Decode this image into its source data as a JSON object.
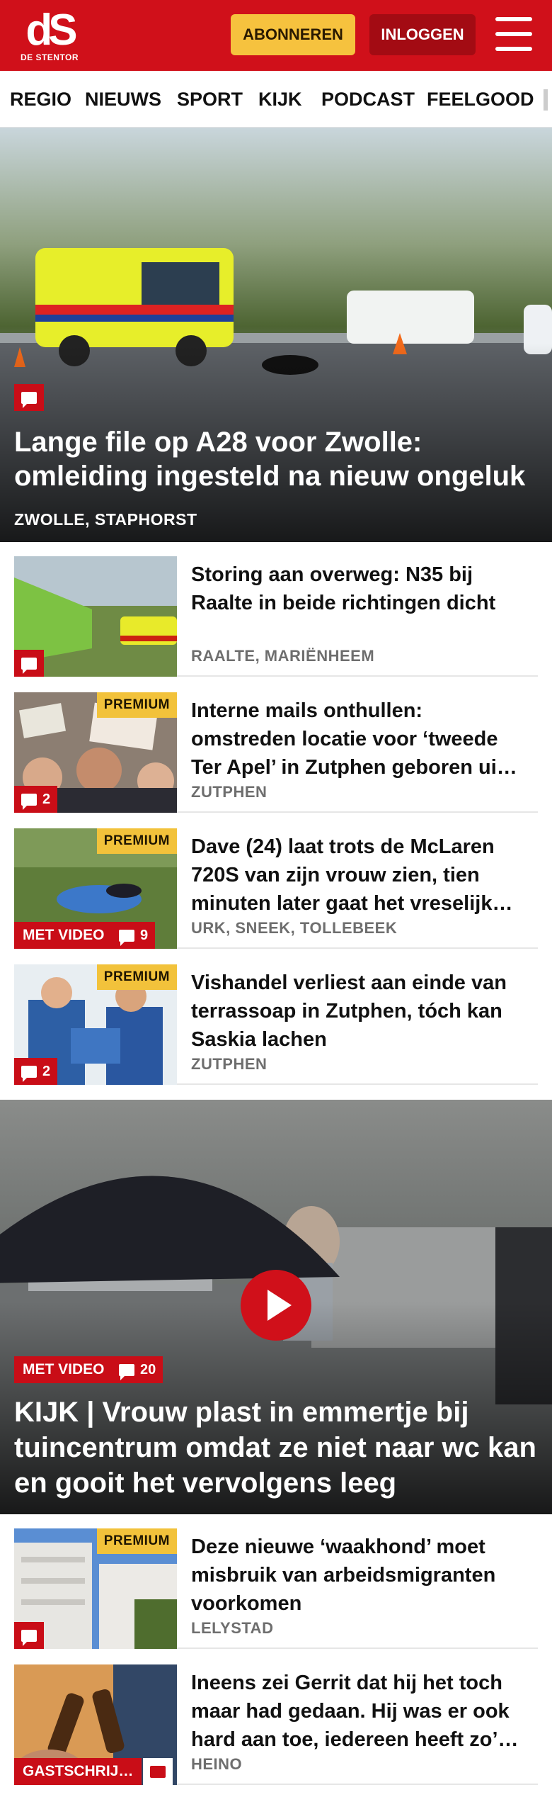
{
  "header": {
    "logo_mark": "dS",
    "logo_sub": "DE STENTOR",
    "subscribe_label": "ABONNEREN",
    "login_label": "INLOGGEN",
    "brand_color": "#d0101a"
  },
  "nav": {
    "items": [
      "REGIO",
      "NIEUWS",
      "SPORT",
      "KIJK",
      "PODCAST",
      "FEELGOOD"
    ]
  },
  "hero": {
    "title": "Lange file op A28 voor Zwolle: omleiding ingesteld na nieuw ongeluk",
    "location": "ZWOLLE, STAPHORST",
    "icon": "comment-icon"
  },
  "articles": [
    {
      "title": "Storing aan overweg: N35 bij Raalte in beide richtingen dicht",
      "location": "RAALTE, MARIËNHEEM",
      "comments": ""
    },
    {
      "title": "Interne mails onthullen: omstreden locatie voor ‘tweede Ter Apel’ in Zutphen geboren ui…",
      "location": "ZUTPHEN",
      "premium": "PREMIUM",
      "comments": "2"
    },
    {
      "title": "Dave (24) laat trots de McLaren 720S van zijn vrouw zien, tien minuten later gaat het vreselijk…",
      "location": "URK, SNEEK, TOLLEBEEK",
      "premium": "PREMIUM",
      "video_label": "MET VIDEO",
      "comments": "9"
    },
    {
      "title": "Vishandel verliest aan einde van terrassoap in Zutphen, tóch kan Saskia lachen",
      "location": "ZUTPHEN",
      "premium": "PREMIUM",
      "comments": "2"
    }
  ],
  "video_hero": {
    "video_label": "MET VIDEO",
    "comments": "20",
    "title": "KIJK | Vrouw plast in emmertje bij tuincentrum omdat ze niet naar wc kan en gooit het vervolgens leeg",
    "icon": "play-icon"
  },
  "articles2": [
    {
      "title": "Deze nieuwe ‘waakhond’ moet misbruik van arbeidsmigranten voorkomen",
      "location": "LELYSTAD",
      "premium": "PREMIUM",
      "comments": ""
    },
    {
      "title": "Ineens zei Gerrit dat hij het toch maar had gedaan. Hij was er ook hard aan toe, iedereen heeft zo’…",
      "location": "HEINO",
      "tag": "GASTSCHRIJ…",
      "comments": ""
    }
  ]
}
